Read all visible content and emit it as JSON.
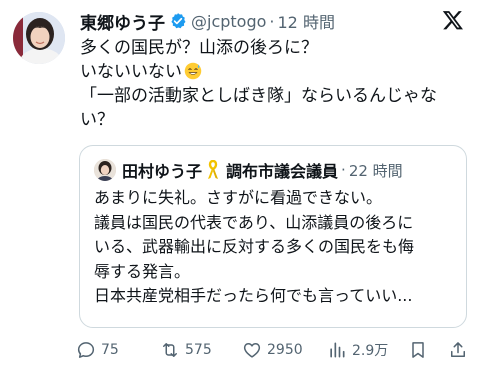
{
  "tweet": {
    "author_name": "東郷ゆう子",
    "handle": "@jcptogo",
    "separator": "·",
    "time": "12 時間",
    "lines": [
      "多くの国民が？山添の後ろに？",
      "いないいない",
      "「一部の活動家としばき隊」ならいるんじゃな",
      "い？"
    ],
    "emoji": "sweat-smile-emoji"
  },
  "quote": {
    "author_name": "田村ゆう子",
    "ribbon": "yellow-ribbon-icon",
    "title": "調布市議会議員",
    "separator": "·",
    "time": "22 時間",
    "lines": [
      "あまりに失礼。さすがに看過できない。",
      "議員は国民の代表であり、山添議員の後ろに",
      "いる、武器輸出に反対する多くの国民をも侮",
      "辱する発言。",
      "日本共産党相手だったら何でも言っていい..."
    ]
  },
  "actions": {
    "reply_count": "75",
    "repost_count": "575",
    "like_count": "2950",
    "view_count": "2.9万"
  },
  "colors": {
    "text": "#0f1419",
    "secondary": "#536471",
    "verified": "#1d9bf0",
    "border": "#cfd9de"
  }
}
